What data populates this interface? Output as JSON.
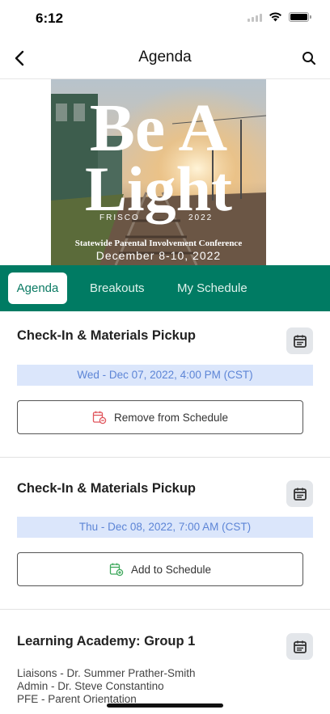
{
  "status": {
    "time": "6:12"
  },
  "header": {
    "title": "Agenda"
  },
  "banner": {
    "line1": "Be A",
    "line2": "Light",
    "city": "FRISCO",
    "year": "2022",
    "subtitle": "Statewide Parental Involvement Conference",
    "dates": "December 8-10, 2022"
  },
  "tabs": [
    {
      "label": "Agenda",
      "active": true
    },
    {
      "label": "Breakouts",
      "active": false
    },
    {
      "label": "My Schedule",
      "active": false
    }
  ],
  "sessions": [
    {
      "title": "Check-In & Materials Pickup",
      "datetime": "Wed - Dec 07, 2022, 4:00 PM (CST)",
      "action": "Remove from Schedule",
      "action_icon": "calendar-remove-icon",
      "action_color": "#e0555c"
    },
    {
      "title": "Check-In & Materials Pickup",
      "datetime": "Thu - Dec 08, 2022, 7:00 AM (CST)",
      "action": "Add to Schedule",
      "action_icon": "calendar-add-icon",
      "action_color": "#3fa85c"
    },
    {
      "title": "Learning Academy: Group 1",
      "speakers": [
        "Liaisons - Dr. Summer Prather-Smith",
        "Admin - Dr. Steve Constantino",
        "PFE - Parent Orientation"
      ]
    }
  ],
  "colors": {
    "tab_bar": "#007b63",
    "date_chip_bg": "#dbe6fb",
    "date_chip_text": "#5d85d6"
  }
}
